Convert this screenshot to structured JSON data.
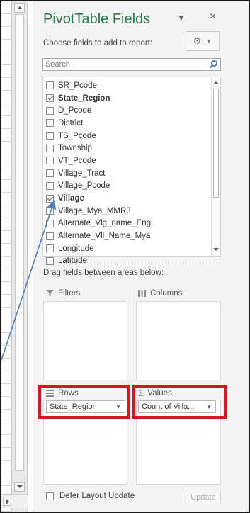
{
  "panel": {
    "title": "PivotTable Fields",
    "choose_label": "Choose fields to add to report:",
    "search_placeholder": "Search"
  },
  "fields": [
    {
      "label": "SR_Pcode",
      "checked": false
    },
    {
      "label": "State_Region",
      "checked": true
    },
    {
      "label": "D_Pcode",
      "checked": false
    },
    {
      "label": "District",
      "checked": false
    },
    {
      "label": "TS_Pcode",
      "checked": false
    },
    {
      "label": "Township",
      "checked": false
    },
    {
      "label": "VT_Pcode",
      "checked": false
    },
    {
      "label": "Village_Tract",
      "checked": false
    },
    {
      "label": "Village_Pcode",
      "checked": false
    },
    {
      "label": "Village",
      "checked": true
    },
    {
      "label": "Village_Mya_MMR3",
      "checked": false
    },
    {
      "label": "Alternate_Vlg_name_Eng",
      "checked": false
    },
    {
      "label": "Alternate_Vll_Name_Mya",
      "checked": false
    },
    {
      "label": "Longitude",
      "checked": false
    },
    {
      "label": "Latitude",
      "checked": false
    }
  ],
  "areas": {
    "drag_label": "Drag fields between areas below:",
    "filters_label": "Filters",
    "columns_label": "Columns",
    "rows_label": "Rows",
    "values_label": "Values",
    "rows_item": "State_Region",
    "values_item": "Count of Villa..."
  },
  "footer": {
    "defer_label": "Defer Layout Update",
    "update_label": "Update"
  },
  "colors": {
    "title_green": "#2b7a4b",
    "highlight_red": "#e0101c",
    "arrow_blue": "#4a7fc0"
  },
  "icons": [
    "filter-icon",
    "columns-icon",
    "rows-icon",
    "sigma-icon",
    "gear-icon",
    "search-icon",
    "close-icon"
  ]
}
